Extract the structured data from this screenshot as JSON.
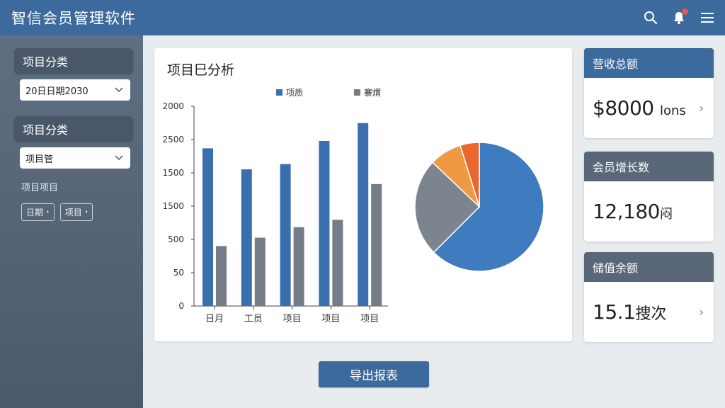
{
  "app": {
    "title": "智信会员管理软件"
  },
  "topbar": {
    "icons": [
      "search-icon",
      "bell-icon",
      "menu-icon"
    ],
    "accent": "#3d6a9c",
    "badge_color": "#e05a4f"
  },
  "sidebar": {
    "section1": {
      "heading": "项目分类",
      "select_value": "20日日期2030"
    },
    "section2": {
      "heading": "项目分类",
      "select_value": "项目管"
    },
    "filter_label": "项目项目",
    "tags": [
      "日期",
      "项目"
    ]
  },
  "panel": {
    "title": "项目巳分析"
  },
  "chart_data": [
    {
      "type": "bar",
      "categories": [
        "日月",
        "工员",
        "项目",
        "项目",
        "项目"
      ],
      "series": [
        {
          "name": "项质",
          "values": [
            1500,
            1300,
            1350,
            1570,
            1740
          ],
          "color": "#3a6fae"
        },
        {
          "name": "褰煟",
          "values": [
            570,
            650,
            750,
            820,
            1160
          ],
          "color": "#737c87"
        }
      ],
      "yticks": [
        "0",
        "50",
        "500",
        "1500",
        "1500",
        "2500",
        "2000"
      ],
      "ylim": [
        0,
        1900
      ],
      "grid": false,
      "legend": "top"
    },
    {
      "type": "pie",
      "slices": [
        {
          "value": 62.5,
          "color": "#3f7bbf"
        },
        {
          "value": 24.6,
          "color": "#7b848f"
        },
        {
          "value": 8.1,
          "color": "#ef9a42"
        },
        {
          "value": 4.8,
          "color": "#e9672e"
        }
      ]
    }
  ],
  "cards": [
    {
      "title": "营收总额",
      "value": "$8000 ",
      "unit": "lons",
      "head_color": "#3d6a9c",
      "has_chevron": true
    },
    {
      "title": "会员增长数",
      "value": "12,180",
      "unit": "闷",
      "head_color": "#5a6778",
      "has_chevron": false
    },
    {
      "title": "储值余额",
      "value": "15.1",
      "unit": "捜次",
      "head_color": "#5a6778",
      "has_chevron": true
    }
  ],
  "actions": {
    "export_label": "导出报表"
  }
}
